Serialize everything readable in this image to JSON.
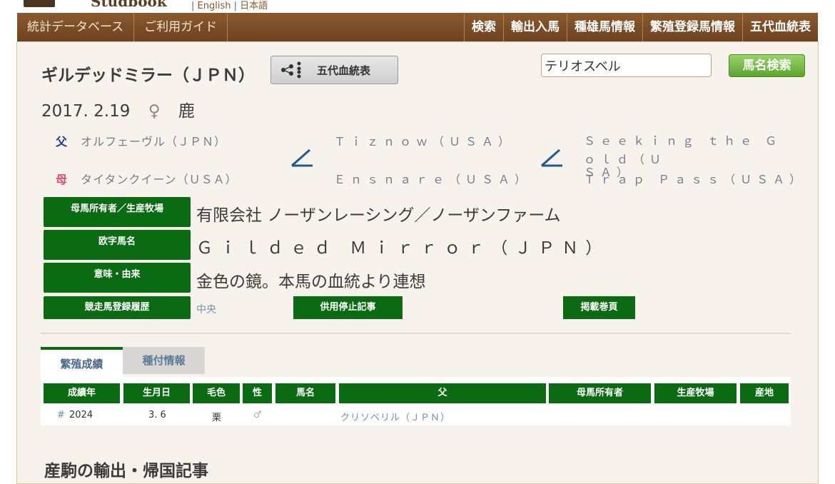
{
  "header": {
    "logo_text": "Studbook",
    "lang_sep1": "|",
    "lang_english": "English",
    "lang_sep2": "|",
    "lang_japanese": "日本語"
  },
  "nav": {
    "left": [
      "統計データベース",
      "ご利用ガイド"
    ],
    "right": [
      "検索",
      "輸出入馬",
      "種雄馬情報",
      "繁殖登録馬情報",
      "五代血統表"
    ]
  },
  "horse": {
    "name": "ギルデッドミラー（ＪＰＮ）",
    "pedigree_button": "五代血統表",
    "birth_date": "2017. 2.19",
    "sex_symbol": "♀",
    "color": "鹿"
  },
  "search": {
    "value": "テリオスベル",
    "button": "馬名検索"
  },
  "pedigree": {
    "sire_label": "父",
    "sire": "オルフェーヴル（ＪＰＮ）",
    "dam_label": "母",
    "dam": "タイタンクイーン（ＵＳＡ）",
    "dam_sire": "Ｔｉｚｎｏｗ（ＵＳＡ）",
    "dam_dam": "Ｅｎｓｎａｒｅ（ＵＳＡ）",
    "dam_sire_sire_line1": "Ｓｅｅｋｉｎｇ ｔｈｅ Ｇｏｌｄ（Ｕ",
    "dam_sire_sire_line2": "ＳＡ）",
    "dam_sire_dam": "Ｔｒａｐ Ｐａｓｓ（ＵＳＡ）"
  },
  "info": {
    "owner_label": "母馬所有者／生産牧場",
    "owner_value": "有限会社 ノーザンレーシング／ノーザンファーム",
    "roman_label": "欧字馬名",
    "roman_value": "Ｇｉｌｄｅｄ Ｍｉｒｒｏｒ（ＪＰＮ）",
    "meaning_label": "意味・由来",
    "meaning_value": "金色の鏡。本馬の血統より連想",
    "racing_label": "競走馬登録履歴",
    "racing_value": "中央",
    "suspension_button": "供用停止記事",
    "page_button": "掲載巻頁"
  },
  "tabs": [
    "繁殖成績",
    "種付情報"
  ],
  "table": {
    "headers": [
      "成績年",
      "生月日",
      "毛色",
      "性",
      "馬名",
      "父",
      "母馬所有者",
      "生産牧場",
      "産地"
    ],
    "rows": [
      {
        "hash": "#",
        "year": "2024",
        "birth": "3. 6",
        "color": "栗",
        "sex": "♂",
        "name": "",
        "sire": "クリソベリル（ＪＰＮ）",
        "owner": "",
        "farm": "",
        "origin": ""
      }
    ]
  },
  "section_title": "産駒の輸出・帰国記事"
}
